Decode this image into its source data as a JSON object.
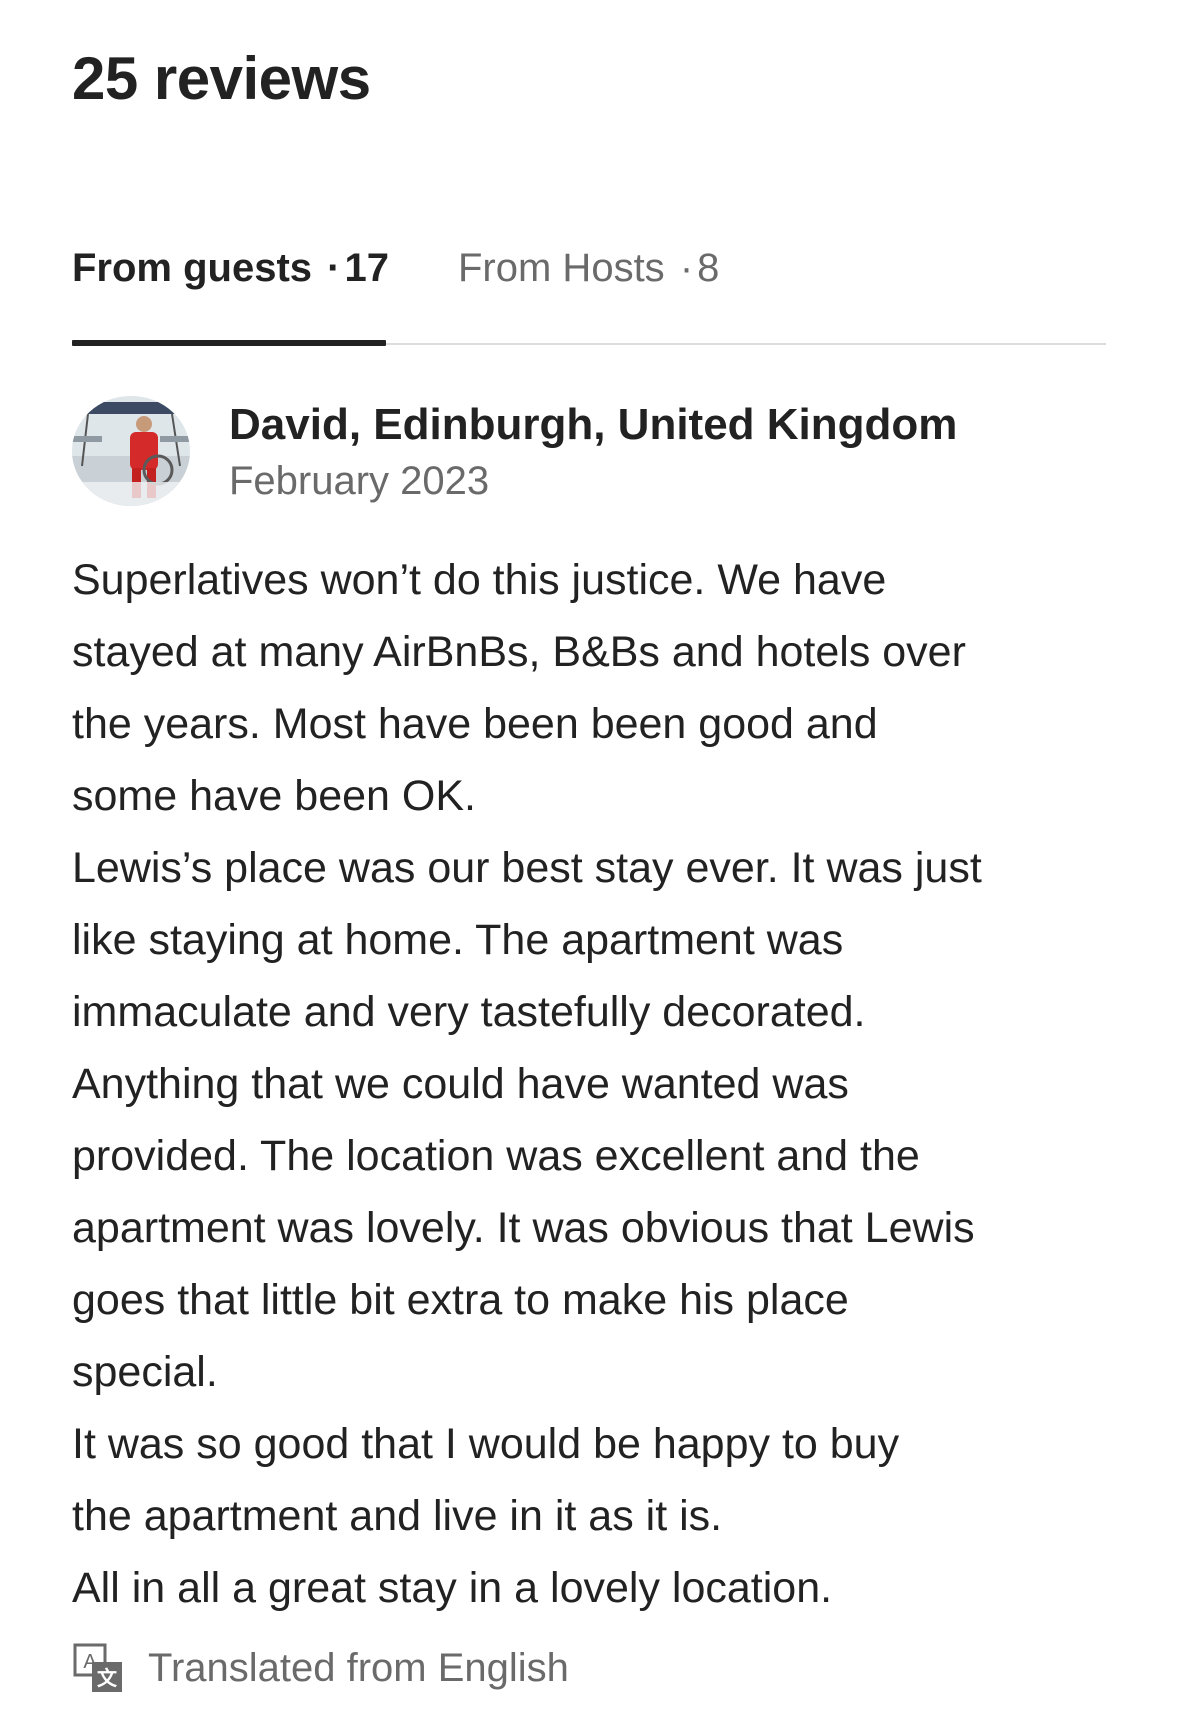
{
  "header": {
    "title": "25 reviews"
  },
  "tabs": [
    {
      "label": "From guests",
      "separator": "·",
      "count": "17",
      "active": true
    },
    {
      "label": "From Hosts",
      "separator": "·",
      "count": "8",
      "active": false
    }
  ],
  "review": {
    "avatar_icon": "user-photo-avatar",
    "reviewer": "David, Edinburgh, United Kingdom",
    "date": "February 2023",
    "lines": [
      "Superlatives won’t do this justice. We have",
      "stayed at many AirBnBs, B&Bs and hotels over",
      "the years. Most have been been good and",
      "some have been OK.",
      "Lewis’s place was our best stay ever. It was just",
      "like staying at home. The apartment was",
      "immaculate and very tastefully decorated.",
      "Anything that we could have wanted was",
      "provided. The location was excellent and the",
      "apartment was lovely. It was obvious that Lewis",
      "goes that little bit extra to make his place",
      "special.",
      "It was so good that I would be happy to buy",
      "the apartment and live in it as it is.",
      "All in all a great stay in a lovely location."
    ],
    "translation_icon": "translate-icon",
    "translation_note": "Translated from English"
  },
  "colors": {
    "text_primary": "#222222",
    "text_secondary": "#6a6a6a",
    "divider": "#dddddd"
  }
}
